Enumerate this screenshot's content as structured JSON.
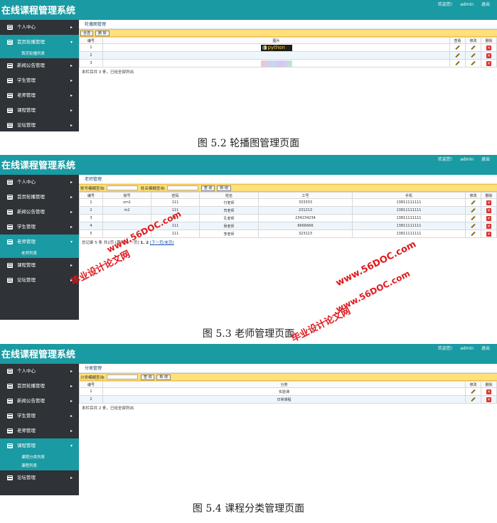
{
  "app_title": "在线课程管理系统",
  "welcome": "欢迎您!",
  "user": "admin",
  "logout": "退出",
  "screens": [
    {
      "caption": "图 5.2 轮播图管理页面",
      "nav": [
        {
          "label": "个人中心",
          "open": false
        },
        {
          "label": "首页轮播管理",
          "open": true,
          "sub": [
            "首页轮播列表"
          ]
        },
        {
          "label": "新闻公告管理",
          "open": false
        },
        {
          "label": "学生管理",
          "open": false
        },
        {
          "label": "老师管理",
          "open": false
        },
        {
          "label": "课程管理",
          "open": false
        },
        {
          "label": "论坛管理",
          "open": false
        }
      ],
      "content_title": "轮播图管理",
      "toolbar_buttons": [
        "全选",
        "删 除"
      ],
      "headers": [
        "编号",
        "图片",
        "查看",
        "修改",
        "删除"
      ],
      "rows": [
        {
          "id": "1",
          "image": "python"
        },
        {
          "id": "2",
          "image": ""
        },
        {
          "id": "3",
          "image": ""
        }
      ],
      "footer": "本栏目共 3 条，已经全部列出"
    },
    {
      "caption": "图 5.3 老师管理页面",
      "nav": [
        {
          "label": "个人中心",
          "open": false
        },
        {
          "label": "首页轮播管理",
          "open": false
        },
        {
          "label": "新闻公告管理",
          "open": false
        },
        {
          "label": "学生管理",
          "open": false
        },
        {
          "label": "老师管理",
          "open": true,
          "sub": [
            "老师列表"
          ]
        },
        {
          "label": "课程管理",
          "open": false
        },
        {
          "label": "论坛管理",
          "open": false
        }
      ],
      "content_title": "老师管理",
      "search_labels": [
        "账号模糊查询:",
        "姓名模糊查询:"
      ],
      "toolbar_buttons": [
        "查 询",
        "新 增"
      ],
      "headers": [
        "编号",
        "账号",
        "密码",
        "姓名",
        "工号",
        "手机",
        "修改",
        "删除"
      ],
      "rows": [
        [
          "1",
          "xm1",
          "111",
          "付老师",
          "333333",
          "13811111111"
        ],
        [
          "2",
          "m2",
          "111",
          "司老师",
          "231213",
          "13811111111"
        ],
        [
          "3",
          "",
          "111",
          "孔老师",
          "234234234",
          "13811111111"
        ],
        [
          "4",
          "",
          "111",
          "吴老师",
          "6666666",
          "13811111111"
        ],
        [
          "5",
          "",
          "111",
          "李老师",
          "323123",
          "13811111111"
        ]
      ],
      "pager": {
        "summary": "总记录 5 条 共2页",
        "nav": "[首页/上一页]",
        "pages": "1. 2",
        "links": "[下一页/末页]"
      }
    },
    {
      "caption": "图 5.4 课程分类管理页面",
      "nav": [
        {
          "label": "个人中心",
          "open": false
        },
        {
          "label": "首页轮播管理",
          "open": false
        },
        {
          "label": "新闻公告管理",
          "open": false
        },
        {
          "label": "学生管理",
          "open": false
        },
        {
          "label": "老师管理",
          "open": false
        },
        {
          "label": "课程管理",
          "open": true,
          "sub": [
            "课程分类列表",
            "课程列表"
          ]
        },
        {
          "label": "论坛管理",
          "open": false
        }
      ],
      "content_title": "分类管理",
      "search_labels": [
        "分类模糊查询:"
      ],
      "toolbar_buttons": [
        "查 询",
        "新 增"
      ],
      "headers": [
        "编号",
        "分类",
        "修改",
        "删除"
      ],
      "rows": [
        [
          "1",
          "实验课"
        ],
        [
          "2",
          "日常课程"
        ]
      ],
      "footer": "本栏目共 2 条，已经全部列出"
    }
  ],
  "watermarks": [
    "www.56DOC.com",
    "毕业设计论文网",
    "www.56DOC.com",
    "毕业设计论文网",
    "www.56DOC.com"
  ]
}
